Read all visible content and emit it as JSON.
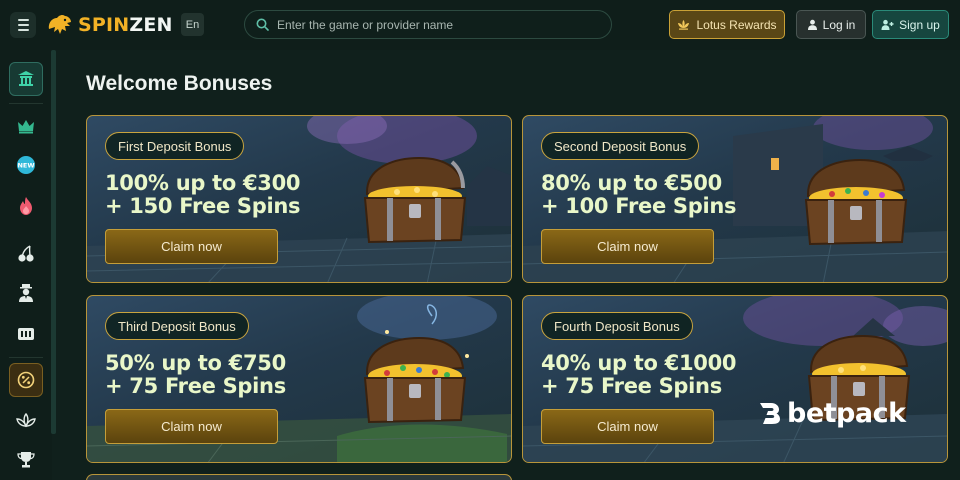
{
  "header": {
    "brand": {
      "part1": "SPIN",
      "part2": "ZEN"
    },
    "language": "En",
    "search_placeholder": "Enter the game or provider name",
    "lotus_label": "Lotus Rewards",
    "login_label": "Log in",
    "signup_label": "Sign up"
  },
  "sidebar": {
    "items": [
      {
        "icon": "temple-icon",
        "active": true
      },
      {
        "icon": "crown-icon"
      },
      {
        "icon": "new-badge-icon",
        "text": "NEW"
      },
      {
        "icon": "flame-icon"
      },
      {
        "icon": "cherries-icon"
      },
      {
        "icon": "dealer-icon"
      },
      {
        "icon": "ticket-icon"
      },
      {
        "icon": "promo-percent-icon",
        "promo": true
      },
      {
        "icon": "lotus-icon"
      },
      {
        "icon": "trophy-icon"
      }
    ]
  },
  "main": {
    "title": "Welcome Bonuses",
    "cards": [
      {
        "tag": "First Deposit Bonus",
        "line1": "100% up to €300",
        "line2": "+ 150 Free Spins",
        "cta": "Claim now"
      },
      {
        "tag": "Second Deposit Bonus",
        "line1": "80% up to €500",
        "line2": "+ 100 Free Spins",
        "cta": "Claim now"
      },
      {
        "tag": "Third Deposit Bonus",
        "line1": "50% up to €750",
        "line2": "+ 75 Free Spins",
        "cta": "Claim now"
      },
      {
        "tag": "Fourth Deposit Bonus",
        "line1": "40% up to €1000",
        "line2": "+ 75 Free Spins",
        "cta": "Claim now"
      }
    ]
  },
  "watermark": "betpack",
  "colors": {
    "accent_gold": "#c9a43e",
    "brand_teal": "#2a8a79",
    "background": "#10201c"
  }
}
